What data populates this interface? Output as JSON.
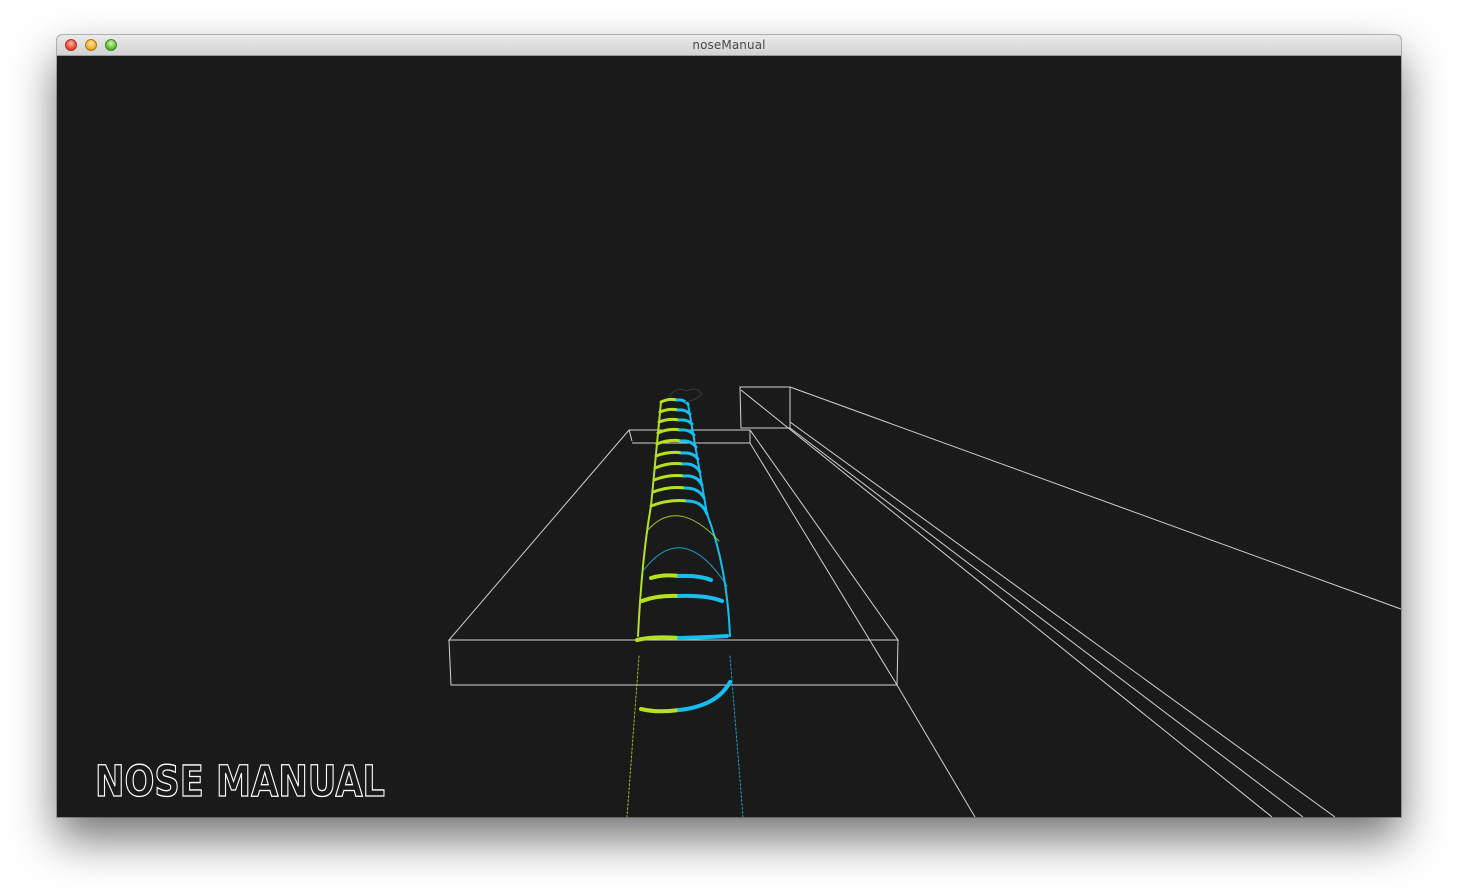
{
  "window": {
    "title": "noseManual",
    "controls": [
      "close",
      "minimize",
      "zoom"
    ]
  },
  "canvas": {
    "background": "#1a1a1a",
    "wire_color": "#e6e6e6"
  },
  "logo": {
    "text": "NOSE MANUAL",
    "color": "#ffffff"
  },
  "tube": {
    "left_color": "#b4e21e",
    "right_color": "#16bff0"
  }
}
